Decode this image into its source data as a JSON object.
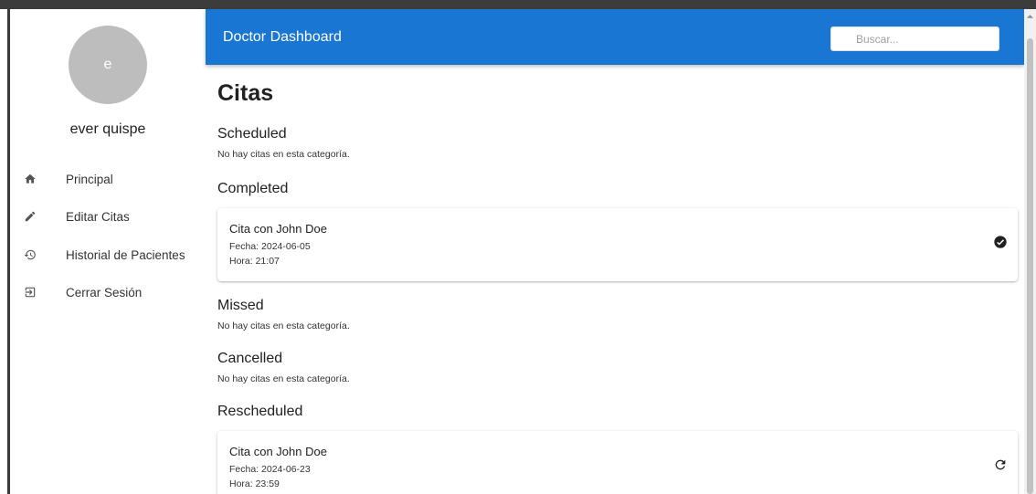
{
  "sidebar": {
    "avatar_letter": "e",
    "user_name": "ever quispe",
    "items": [
      {
        "label": "Principal",
        "icon": "home-icon"
      },
      {
        "label": "Editar Citas",
        "icon": "pencil-icon"
      },
      {
        "label": "Historial de Pacientes",
        "icon": "history-icon"
      },
      {
        "label": "Cerrar Sesión",
        "icon": "logout-icon"
      }
    ]
  },
  "header": {
    "title": "Doctor Dashboard",
    "search_placeholder": "Buscar..."
  },
  "main": {
    "page_title": "Citas",
    "sections": [
      {
        "title": "Scheduled",
        "empty_message": "No hay citas en esta categoría."
      },
      {
        "title": "Completed",
        "appointments": [
          {
            "title": "Cita con John Doe",
            "date": "Fecha: 2024-06-05",
            "time": "Hora: 21:07",
            "status_icon": "check-circle-icon"
          }
        ]
      },
      {
        "title": "Missed",
        "empty_message": "No hay citas en esta categoría."
      },
      {
        "title": "Cancelled",
        "empty_message": "No hay citas en esta categoría."
      },
      {
        "title": "Rescheduled",
        "appointments": [
          {
            "title": "Cita con John Doe",
            "date": "Fecha: 2024-06-23",
            "time": "Hora: 23:59",
            "status_icon": "refresh-icon"
          }
        ]
      }
    ]
  },
  "colors": {
    "appbar": "#1976d2",
    "avatar": "#bdbdbd"
  }
}
